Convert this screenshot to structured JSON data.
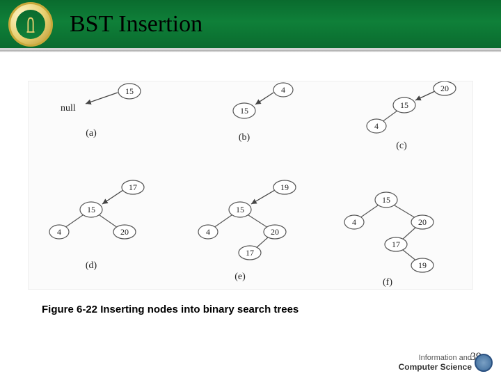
{
  "header": {
    "title": "BST Insertion"
  },
  "figure": {
    "panels": {
      "a": {
        "label": "(a)",
        "null_text": "null",
        "new_value": "15"
      },
      "b": {
        "label": "(b)",
        "root": "15",
        "new_value": "4"
      },
      "c": {
        "label": "(c)",
        "root": "15",
        "left": "4",
        "new_value": "20"
      },
      "d": {
        "label": "(d)",
        "root": "15",
        "left": "4",
        "right": "20",
        "new_value": "17"
      },
      "e": {
        "label": "(e)",
        "root": "15",
        "left": "4",
        "right": "20",
        "right_left": "17",
        "new_value": "19"
      },
      "f": {
        "label": "(f)",
        "root": "15",
        "left": "4",
        "right": "20",
        "right_left": "17",
        "right_left_right": "19"
      }
    }
  },
  "caption": "Figure 6-22 Inserting nodes into binary search trees",
  "page_number": "39",
  "footer": {
    "line1": "Information and",
    "line2": "Computer Science"
  }
}
